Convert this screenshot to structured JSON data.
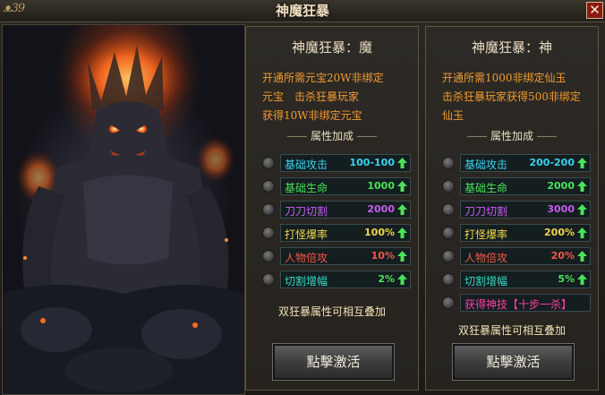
{
  "window": {
    "logo_text": "ᴥ39",
    "title": "神魔狂暴",
    "close_label": "✕"
  },
  "panels": [
    {
      "title": "神魔狂暴：魔",
      "desc_lines": [
        "开通所需元宝20W非绑定",
        "元宝　击杀狂暴玩家",
        "获得10W非绑定元宝"
      ],
      "attr_header": "属性加成",
      "rows": [
        {
          "label": "基础攻击",
          "value": "100-100",
          "label_color": "#38d3ee",
          "value_color": "#38d3ee"
        },
        {
          "label": "基础生命",
          "value": "1000",
          "label_color": "#49e35a",
          "value_color": "#49e35a"
        },
        {
          "label": "刀刀切割",
          "value": "2000",
          "label_color": "#c85cf0",
          "value_color": "#c85cf0"
        },
        {
          "label": "打怪爆率",
          "value": "100%",
          "label_color": "#f0d64b",
          "value_color": "#f0d64b"
        },
        {
          "label": "人物倍攻",
          "value": "10%",
          "label_color": "#f05a47",
          "value_color": "#f05a47"
        },
        {
          "label": "切割增幅",
          "value": "2%",
          "label_color": "#37d9c5",
          "value_color": "#49e35a"
        }
      ],
      "stack_text": "双狂暴属性可相互叠加",
      "button": "點擊激活"
    },
    {
      "title": "神魔狂暴：神",
      "desc_lines": [
        "开通所需1000非绑定仙玉",
        "击杀狂暴玩家获得500非绑定",
        "仙玉"
      ],
      "attr_header": "属性加成",
      "rows": [
        {
          "label": "基础攻击",
          "value": "200-200",
          "label_color": "#38d3ee",
          "value_color": "#38d3ee"
        },
        {
          "label": "基础生命",
          "value": "2000",
          "label_color": "#49e35a",
          "value_color": "#49e35a"
        },
        {
          "label": "刀刀切割",
          "value": "3000",
          "label_color": "#c85cf0",
          "value_color": "#c85cf0"
        },
        {
          "label": "打怪爆率",
          "value": "200%",
          "label_color": "#f0d64b",
          "value_color": "#f0d64b"
        },
        {
          "label": "人物倍攻",
          "value": "20%",
          "label_color": "#f05a47",
          "value_color": "#f05a47"
        },
        {
          "label": "切割增幅",
          "value": "5%",
          "label_color": "#37d9c5",
          "value_color": "#49e35a"
        }
      ],
      "special": "获得神技【十步一杀】",
      "stack_text": "双狂暴属性可相互叠加",
      "button": "點擊激活"
    }
  ],
  "colors": {
    "desc": "#f29a2e",
    "arrow": "#49e35a",
    "special": "#ff3fa4"
  }
}
